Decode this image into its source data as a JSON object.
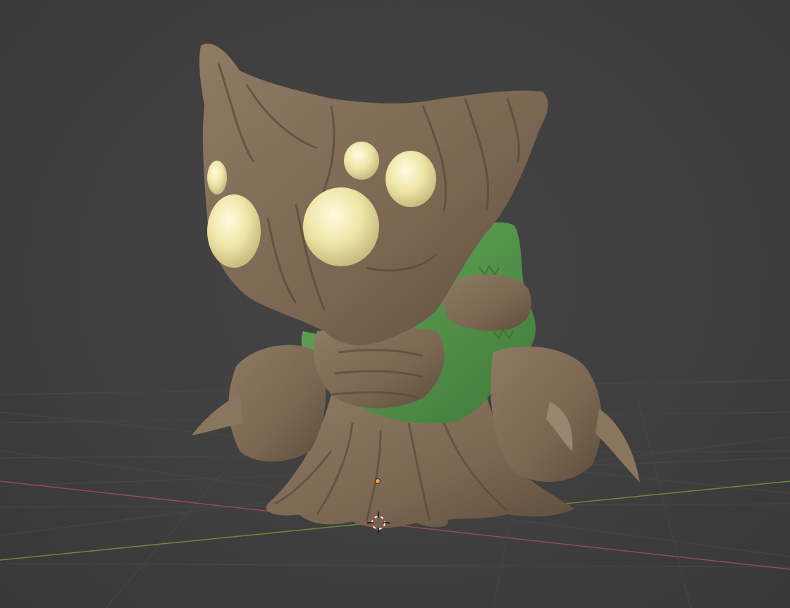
{
  "app": {
    "view": "3d-viewport",
    "shading": "solid"
  },
  "colors": {
    "background": "#3d3d3d",
    "grid_line": "#4a4a4a",
    "x_axis": "#9a4a52",
    "y_axis": "#6b8a3a",
    "bark": "#7d6a55",
    "bark_dark": "#5a4a3a",
    "bark_light": "#9a8670",
    "moss": "#5a9a4e",
    "moss_dark": "#3f7a3a",
    "eye": "#efe6a8",
    "eye_highlight": "#fffbe0",
    "cursor_ring": "#e0e0e0",
    "cursor_red": "#d04040",
    "origin_dot": "#f0a040"
  },
  "scene": {
    "object": "tree-creature-sculpt",
    "icons": [
      "3d-cursor-icon",
      "object-origin-icon"
    ]
  }
}
